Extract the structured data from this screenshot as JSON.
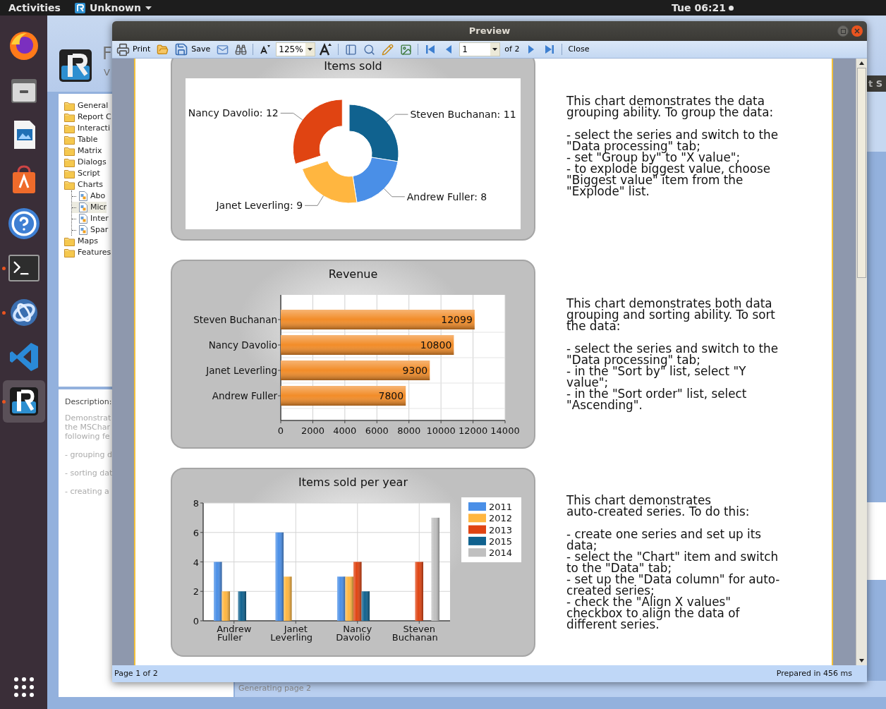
{
  "top_bar": {
    "activities": "Activities",
    "app_name": "Unknown",
    "clock": "Tue 06:21"
  },
  "dock": {
    "items": [
      {
        "running": false,
        "selected": false
      },
      {
        "running": false,
        "selected": false
      },
      {
        "running": false,
        "selected": false
      },
      {
        "running": false,
        "selected": false
      },
      {
        "running": false,
        "selected": false
      },
      {
        "running": true,
        "selected": false
      },
      {
        "running": true,
        "selected": false
      },
      {
        "running": false,
        "selected": false
      },
      {
        "running": true,
        "selected": true
      }
    ]
  },
  "background_app": {
    "title": "F",
    "version": "V",
    "tree": [
      {
        "label": "General"
      },
      {
        "label": "Report C"
      },
      {
        "label": "Interacti"
      },
      {
        "label": "Table"
      },
      {
        "label": "Matrix"
      },
      {
        "label": "Dialogs"
      },
      {
        "label": "Script"
      },
      {
        "label": "Charts",
        "children": [
          {
            "label": "Abo",
            "selected": false
          },
          {
            "label": "Micr",
            "selected": true
          },
          {
            "label": "Inter",
            "selected": false
          },
          {
            "label": "Spar",
            "selected": false
          }
        ]
      },
      {
        "label": "Maps"
      },
      {
        "label": "Features"
      }
    ],
    "description": {
      "label": "Description:",
      "paragraphs": [
        [
          "Demonstrat",
          "the MSChar",
          "following fe"
        ],
        [
          "- grouping d"
        ],
        [
          "- sorting dat"
        ],
        [
          "- creating a"
        ]
      ]
    },
    "right_window_title": "t S",
    "status": "Generating page 2"
  },
  "preview": {
    "title": "Preview",
    "toolbar": [
      {
        "kind": "button",
        "label": "Print"
      },
      {
        "kind": "icon"
      },
      {
        "kind": "button",
        "label": "Save"
      },
      {
        "kind": "icon"
      },
      {
        "kind": "icon"
      },
      {
        "kind": "separator"
      },
      {
        "kind": "icon"
      },
      {
        "kind": "combo",
        "value": "125%"
      },
      {
        "kind": "icon"
      },
      {
        "kind": "separator"
      },
      {
        "kind": "icon"
      },
      {
        "kind": "icon"
      },
      {
        "kind": "icon"
      },
      {
        "kind": "icon"
      },
      {
        "kind": "separator"
      },
      {
        "kind": "icon"
      },
      {
        "kind": "icon"
      },
      {
        "kind": "combo",
        "value": "1"
      },
      {
        "kind": "text",
        "label": "of 2"
      },
      {
        "kind": "icon"
      },
      {
        "kind": "icon"
      },
      {
        "kind": "separator"
      },
      {
        "kind": "button",
        "label": "Close"
      }
    ],
    "sections": [
      {
        "chart_data": {
          "type": "donut",
          "title": "Items sold",
          "values": [
            11,
            8,
            9,
            12
          ],
          "value_labels": [
            "Steven Buchanan: 11",
            "Andrew Fuller: 8",
            "Janet Leverling: 9",
            "Nancy Davolio: 12"
          ]
        },
        "text": [
          "This chart demonstrates the data grouping ability. To group the data:",
          "- select the series and switch to the \"Data processing\" tab;\n- set \"Group by\" to \"X value\";\n- to explode biggest value, choose \"Biggest value\" item from the \"Explode\" list."
        ]
      },
      {
        "chart_data": {
          "type": "bar",
          "orientation": "horizontal",
          "title": "Revenue",
          "categories": [
            "Steven Buchanan",
            "Nancy Davolio",
            "Janet Leverling",
            "Andrew Fuller"
          ],
          "series": [
            {
              "color": "#f28c28",
              "values": [
                12099,
                10800,
                9300,
                7800
              ]
            }
          ],
          "grid": true,
          "xlim": [
            0,
            14000
          ],
          "xticks": [
            0,
            2000,
            4000,
            6000,
            8000,
            10000,
            12000,
            14000
          ],
          "data_labels": true
        },
        "text": [
          "This chart demonstrates both data grouping and sorting ability. To sort the data:",
          "- select the series and switch to the \"Data processing\" tab;\n- in the \"Sort by\" list, select \"Y value\";\n- in the \"Sort order\" list, select \"Ascending\"."
        ]
      },
      {
        "chart_data": {
          "type": "bar",
          "title": "Items sold per year",
          "categories": [
            "Andrew Fuller",
            "Janet Leverling",
            "Nancy Davolio",
            "Steven Buchanan"
          ],
          "series": [
            {
              "name": "2011",
              "color": "#4a8fe7",
              "values": [
                4,
                6,
                3,
                null
              ]
            },
            {
              "name": "2012",
              "color": "#ffb640",
              "values": [
                2,
                3,
                3,
                null
              ]
            },
            {
              "name": "2013",
              "color": "#e04412",
              "values": [
                null,
                null,
                4,
                4
              ]
            },
            {
              "name": "2015",
              "color": "#10628f",
              "values": [
                2,
                null,
                2,
                null
              ]
            },
            {
              "name": "2014",
              "color": "#c0c0c0",
              "values": [
                null,
                null,
                null,
                7
              ]
            }
          ],
          "ylim": [
            0,
            8
          ],
          "yticks": [
            0,
            2,
            4,
            6,
            8
          ],
          "grid": true,
          "legend": true
        },
        "text": [
          "This chart demonstrates\nauto-created series. To do this:",
          "- create one series and set up its data;\n- select the \"Chart\" item and switch to the \"Data\" tab;\n- set up the \"Data column\" for auto-created series;\n- check the \"Align X values\" checkbox to align the data of different series."
        ]
      }
    ],
    "status_bar": {
      "left": "Page 1 of 2",
      "right": "Prepared in 456 ms"
    }
  }
}
